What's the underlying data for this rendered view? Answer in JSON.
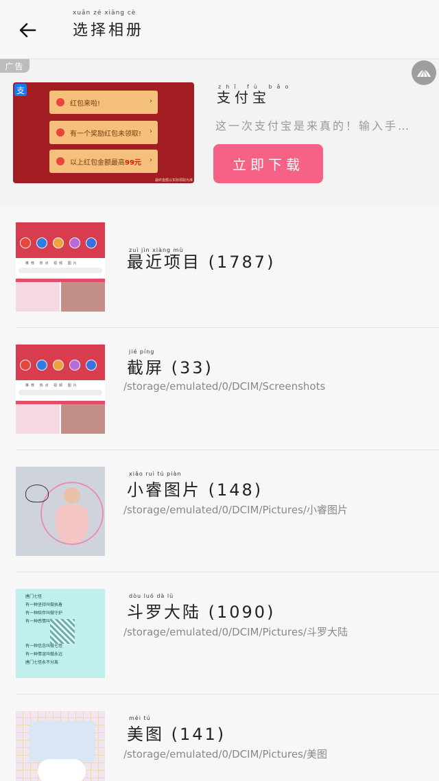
{
  "header": {
    "title": "选择相册",
    "title_pinyin": "xuǎn zé xiāng cè"
  },
  "ad": {
    "tag": "广告",
    "app_name": "支付宝",
    "app_name_pinyin": "zhī fù bǎo",
    "description": "这一次支付宝是来真的！输入手…",
    "button_label": "立即下载",
    "image": {
      "rows": [
        {
          "text": "红包来啦!",
          "highlight": ""
        },
        {
          "text": "有一个奖励红包未领取!",
          "highlight": ""
        },
        {
          "text": "以上红包金额最高",
          "highlight": "99元"
        }
      ],
      "footer": "最终金额以实际领取为准"
    }
  },
  "albums": [
    {
      "title": "最近项目 (1787)",
      "pinyin": "zuì jìn xiàng mù",
      "path": "",
      "thumb_icon": "screenshot-thumbnail"
    },
    {
      "title": "截屏 (33)",
      "pinyin": "jié píng",
      "path": "/storage/emulated/0/DCIM/Screenshots",
      "thumb_icon": "screenshot-thumbnail"
    },
    {
      "title": "小睿图片 (148)",
      "pinyin": "xiǎo ruì tú piàn",
      "path": "/storage/emulated/0/DCIM/Pictures/小睿图片",
      "thumb_icon": "girl-photo-thumbnail"
    },
    {
      "title": "斗罗大陆 (1090)",
      "pinyin": "dòu luó dà lù",
      "path": "/storage/emulated/0/DCIM/Pictures/斗罗大陆",
      "thumb_icon": "text-image-thumbnail"
    },
    {
      "title": "美图 (141)",
      "pinyin": "měi tú",
      "path": "/storage/emulated/0/DCIM/Pictures/美图",
      "thumb_icon": "meitu-thumbnail"
    }
  ],
  "colors": {
    "ad_button": "#f66286",
    "ad_image_bg": "#a11d22",
    "background": "#f7f7f8"
  }
}
